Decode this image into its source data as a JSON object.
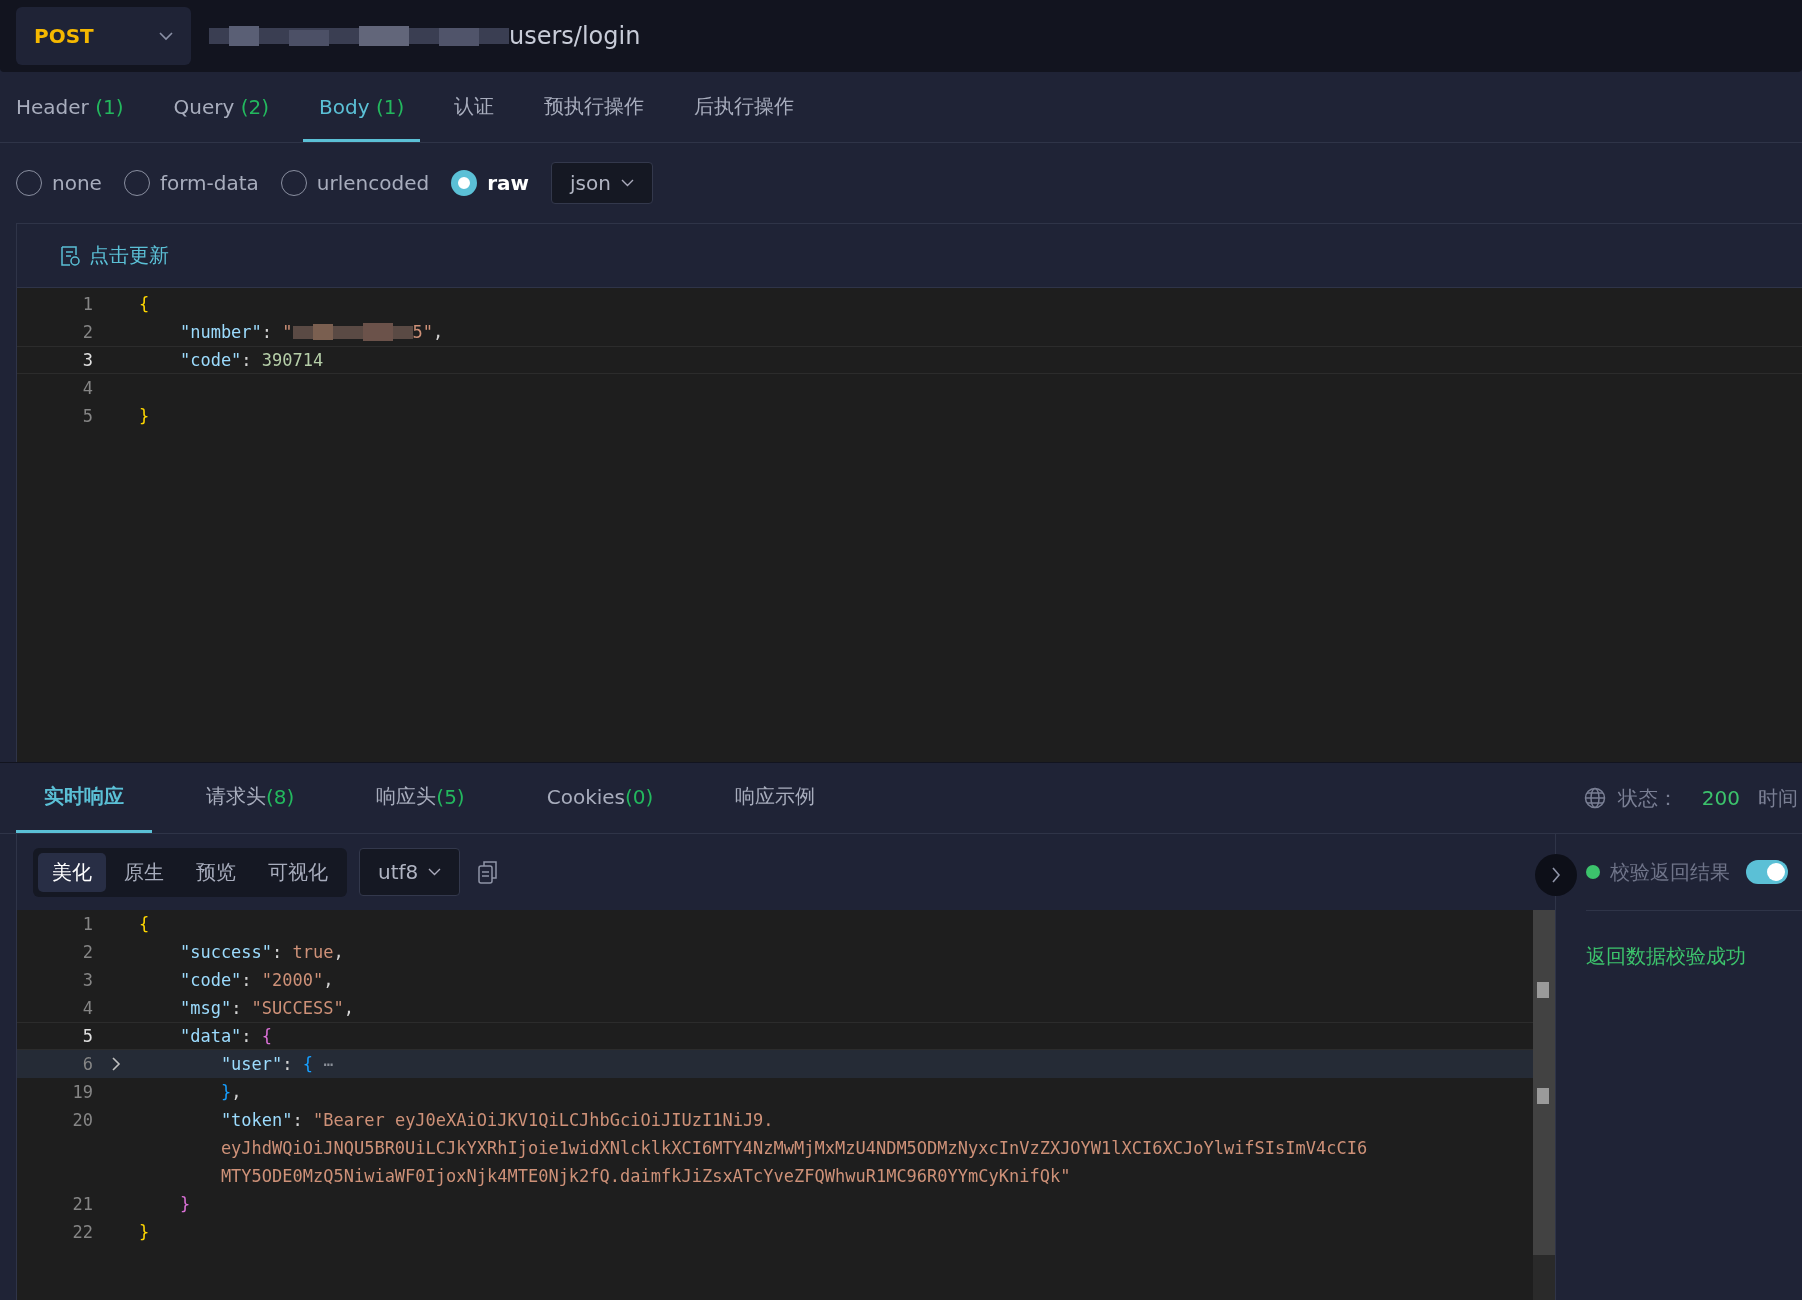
{
  "request": {
    "method": "POST",
    "url": "users/login"
  },
  "tabs": [
    {
      "label": "Header",
      "count": "(1)",
      "selected": false
    },
    {
      "label": "Query",
      "count": "(2)",
      "selected": false
    },
    {
      "label": "Body",
      "count": "(1)",
      "selected": true
    },
    {
      "label": "认证",
      "selected": false
    },
    {
      "label": "预执行操作",
      "selected": false
    },
    {
      "label": "后执行操作",
      "selected": false
    }
  ],
  "body_types": [
    {
      "label": "none",
      "selected": false
    },
    {
      "label": "form-data",
      "selected": false
    },
    {
      "label": "urlencoded",
      "selected": false
    },
    {
      "label": "raw",
      "selected": true
    }
  ],
  "format": "json",
  "refresh_button": "点击更新",
  "request_editor": [
    {
      "num": "1",
      "current": false,
      "tokens": [
        {
          "t": "{",
          "kind": "brace1"
        }
      ]
    },
    {
      "num": "2",
      "current": false,
      "tokens": [
        {
          "t": "    \"number\"",
          "kind": "key"
        },
        {
          "t": ": ",
          "kind": "punct"
        },
        {
          "t": "\"",
          "kind": "str"
        },
        {
          "kind": "redacted"
        },
        {
          "t": "5\"",
          "kind": "str"
        },
        {
          "t": ",",
          "kind": "punct"
        }
      ]
    },
    {
      "num": "3",
      "current": true,
      "tokens": [
        {
          "t": "    \"code\"",
          "kind": "key"
        },
        {
          "t": ": ",
          "kind": "punct"
        },
        {
          "t": "390714",
          "kind": "num"
        }
      ]
    },
    {
      "num": "4",
      "current": false
    },
    {
      "num": "5",
      "current": false,
      "tokens": [
        {
          "t": "}",
          "kind": "brace1"
        }
      ]
    }
  ],
  "response_tabs": [
    {
      "label": "实时响应",
      "selected": true
    },
    {
      "label": "请求头",
      "count": "(8)",
      "selected": false
    },
    {
      "label": "响应头",
      "count": "(5)",
      "selected": false
    },
    {
      "label": "Cookies",
      "count": "(0)",
      "selected": false
    },
    {
      "label": "响应示例",
      "selected": false
    }
  ],
  "status": {
    "label": "状态：",
    "code": "200",
    "time_label": "时间"
  },
  "view_modes": [
    {
      "label": "美化",
      "selected": true
    },
    {
      "label": "原生",
      "selected": false
    },
    {
      "label": "预览",
      "selected": false
    },
    {
      "label": "可视化",
      "selected": false
    }
  ],
  "encoding": "utf8",
  "response_editor": [
    {
      "num": "1",
      "current": false,
      "folded": false,
      "tokens": [
        {
          "t": "{",
          "kind": "brace1"
        }
      ]
    },
    {
      "num": "2",
      "current": false,
      "folded": false,
      "tokens": [
        {
          "t": "    \"success\"",
          "kind": "key"
        },
        {
          "t": ": ",
          "kind": "punct"
        },
        {
          "t": "true",
          "kind": "str"
        },
        {
          "t": ",",
          "kind": "punct"
        }
      ]
    },
    {
      "num": "3",
      "current": false,
      "folded": false,
      "tokens": [
        {
          "t": "    \"code\"",
          "kind": "key"
        },
        {
          "t": ": ",
          "kind": "punct"
        },
        {
          "t": "\"2000\"",
          "kind": "str"
        },
        {
          "t": ",",
          "kind": "punct"
        }
      ]
    },
    {
      "num": "4",
      "current": false,
      "folded": false,
      "tokens": [
        {
          "t": "    \"msg\"",
          "kind": "key"
        },
        {
          "t": ": ",
          "kind": "punct"
        },
        {
          "t": "\"SUCCESS\"",
          "kind": "str"
        },
        {
          "t": ",",
          "kind": "punct"
        }
      ]
    },
    {
      "num": "5",
      "current": true,
      "folded": false,
      "tokens": [
        {
          "t": "    \"data\"",
          "kind": "key"
        },
        {
          "t": ": ",
          "kind": "punct"
        },
        {
          "t": "{",
          "kind": "brace2"
        }
      ]
    },
    {
      "num": "6",
      "current": false,
      "folded": true,
      "tokens": [
        {
          "t": "        \"user\"",
          "kind": "key"
        },
        {
          "t": ": ",
          "kind": "punct"
        },
        {
          "t": "{",
          "kind": "brace3"
        },
        {
          "t": " ⋯",
          "kind": "ellipsis"
        }
      ]
    },
    {
      "num": "19",
      "current": false,
      "folded": false,
      "tokens": [
        {
          "t": "        }",
          "kind": "brace3"
        },
        {
          "t": ",",
          "kind": "punct"
        }
      ]
    },
    {
      "num": "20",
      "current": false,
      "folded": false,
      "tokens": [
        {
          "t": "        \"token\"",
          "kind": "key"
        },
        {
          "t": ": ",
          "kind": "punct"
        },
        {
          "t": "\"Bearer eyJ0eXAiOiJKV1QiLCJhbGciOiJIUzI1NiJ9.",
          "kind": "str"
        }
      ]
    },
    {
      "current": false,
      "folded": false,
      "tokens": [
        {
          "t": "        eyJhdWQiOiJNQU5BR0UiLCJkYXRhIjoie1widXNlcklkXCI6MTY4NzMwMjMxMzU4NDM5ODMzNyxcInVzZXJOYW1lXCI6XCJoYlwifSIsImV4cCI6",
          "kind": "str"
        }
      ]
    },
    {
      "current": false,
      "folded": false,
      "tokens": [
        {
          "t": "        MTY5ODE0MzQ5NiwiaWF0IjoxNjk4MTE0Njk2fQ.daimfkJiZsxATcYveZFQWhwuR1MC96R0YYmCyKnifQk\"",
          "kind": "str"
        }
      ]
    },
    {
      "num": "21",
      "current": false,
      "folded": false,
      "tokens": [
        {
          "t": "    }",
          "kind": "brace2"
        }
      ]
    },
    {
      "num": "22",
      "current": false,
      "folded": false,
      "tokens": [
        {
          "t": "}",
          "kind": "brace1"
        }
      ]
    }
  ],
  "validation": {
    "label": "校验返回结果",
    "on": true,
    "color": "#3cc36c",
    "result": "返回数据校验成功"
  }
}
